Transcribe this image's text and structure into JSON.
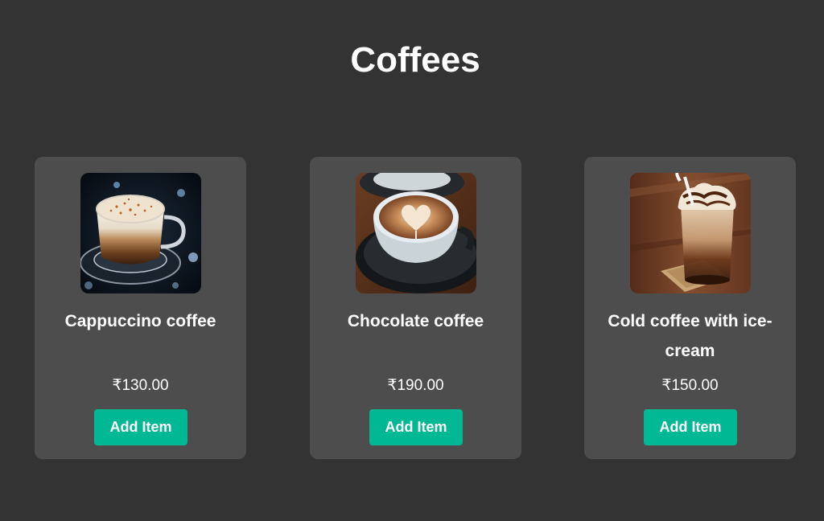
{
  "page": {
    "title": "Coffees"
  },
  "products": [
    {
      "name": "Cappuccino coffee",
      "price": "₹130.00",
      "button_label": "Add Item",
      "image": "cappuccino-photo"
    },
    {
      "name": "Chocolate coffee",
      "price": "₹190.00",
      "button_label": "Add Item",
      "image": "chocolate-coffee-photo"
    },
    {
      "name": "Cold coffee with ice-cream",
      "price": "₹150.00",
      "button_label": "Add Item",
      "image": "cold-coffee-photo"
    }
  ],
  "colors": {
    "background": "#333333",
    "card": "#4d4d4d",
    "accent": "#00b894",
    "text": "#ffffff"
  }
}
